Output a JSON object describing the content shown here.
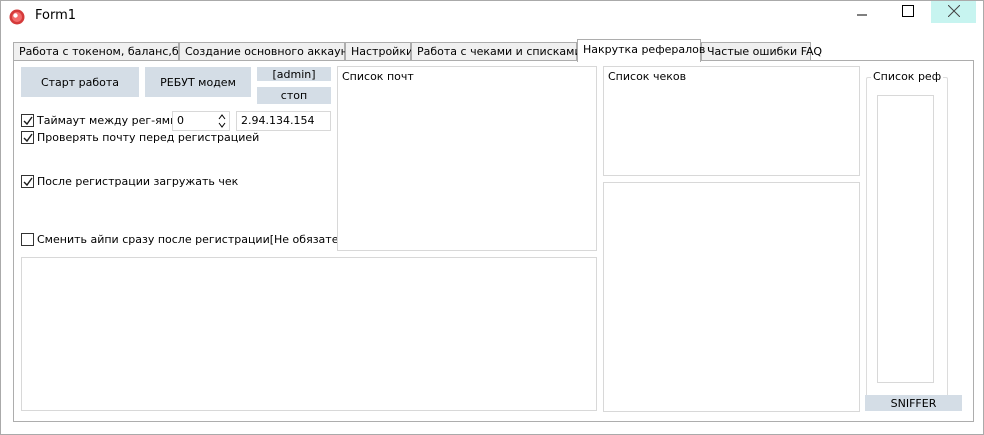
{
  "window": {
    "title": "Form1",
    "icons": {
      "app": "red-circle-app-icon",
      "minimize": "minimize-icon",
      "maximize": "maximize-icon",
      "close": "close-icon"
    }
  },
  "tabs": [
    {
      "label": "Работа с токеном, баланс,бан"
    },
    {
      "label": "Создание основного аккаунта"
    },
    {
      "label": "Настройки"
    },
    {
      "label": "Работа с чеками и списками IP"
    },
    {
      "label": "Накрутка рефералов"
    },
    {
      "label": "Частые ошибки FAQ"
    }
  ],
  "active_tab": "Накрутка рефералов",
  "controls": {
    "start_button": "Старт работа",
    "reboot_button": "РЕБУТ модем",
    "admin_button": "[admin]",
    "stop_button": "стоп",
    "timeout_label": "Таймаут между рег-ями",
    "timeout_value": "0",
    "ip_value": "2.94.134.154",
    "check_mail_label": "Проверять почту перед регистрацией",
    "load_check_label": "После регистрации загружать чек",
    "change_ip_label": "Сменить айпи сразу после регистрации[Не обязательно]"
  },
  "checkboxes": {
    "timeout": true,
    "check_mail": true,
    "load_check": true,
    "change_ip": false
  },
  "panels": {
    "mail_list": "Список почт",
    "check_list": "Список чеков",
    "ref_list": "Список реф"
  },
  "sniffer_button": "SNIFFER",
  "colors": {
    "button_bg": "#d4dde6",
    "close_hover": "#c7f4f0",
    "border": "#adadad"
  }
}
